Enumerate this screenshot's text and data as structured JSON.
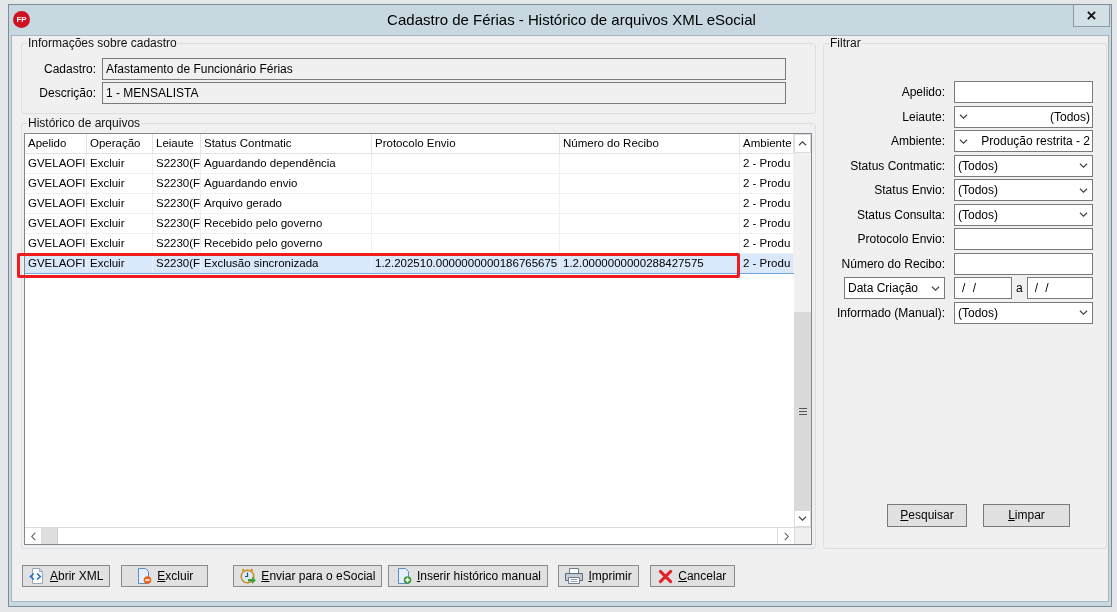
{
  "window": {
    "logo": "FP",
    "title": "Cadastro de Férias - Histórico de arquivos XML eSocial"
  },
  "info_group": {
    "legend": "Informações sobre cadastro",
    "fields": [
      {
        "label": "Cadastro:",
        "value": "Afastamento de Funcionário Férias"
      },
      {
        "label": "Descrição:",
        "value": "1 - MENSALISTA"
      }
    ]
  },
  "history_group": {
    "legend": "Histórico de arquivos",
    "table": {
      "columns": [
        "Apelido",
        "Operação",
        "Leiaute",
        "Status Contmatic",
        "Protocolo Envio",
        "Número do Recibo",
        "Ambiente"
      ],
      "rows": [
        {
          "apelido": "GVELAOFI",
          "operacao": "Excluir",
          "leiaute": "S2230(F",
          "status_contmatic": "Aguardando dependência",
          "ambiente": "2 - Produ",
          "selected": false,
          "highlighted": false
        },
        {
          "apelido": "GVELAOFI",
          "operacao": "Excluir",
          "leiaute": "S2230(F",
          "status_contmatic": "Aguardando envio",
          "ambiente": "2 - Produ",
          "selected": false,
          "highlighted": false
        },
        {
          "apelido": "GVELAOFI",
          "operacao": "Excluir",
          "leiaute": "S2230(F",
          "status_contmatic": "Arquivo gerado",
          "ambiente": "2 - Produ",
          "selected": false,
          "highlighted": false
        },
        {
          "apelido": "GVELAOFI",
          "operacao": "Excluir",
          "leiaute": "S2230(F",
          "status_contmatic": "Recebido pelo governo",
          "ambiente": "2 - Produ",
          "selected": false,
          "highlighted": false
        },
        {
          "apelido": "GVELAOFI",
          "operacao": "Excluir",
          "leiaute": "S2230(F",
          "status_contmatic": "Recebido pelo governo",
          "ambiente": "2 - Produ",
          "selected": false,
          "highlighted": false
        },
        {
          "apelido": "GVELAOFI",
          "operacao": "Excluir",
          "leiaute": "S2230(F",
          "status_contmatic": "Exclusão sincronizada",
          "protocolo_envio": "1.2.202510.0000000000186765675",
          "numero_do_recibo": "1.2.0000000000288427575",
          "ambiente": "2 - Produ",
          "selected": true,
          "highlighted": true
        }
      ]
    }
  },
  "filter_group": {
    "legend": "Filtrar",
    "fields": [
      {
        "kind": "input",
        "label": "Apelido:"
      },
      {
        "kind": "combo_reversed",
        "label": "Leiaute:",
        "value": "(Todos)"
      },
      {
        "kind": "combo_reversed",
        "label": "Ambiente:",
        "value": "Produção restrita - 2"
      },
      {
        "kind": "combo",
        "label": "Status Contmatic:",
        "value": "(Todos)"
      },
      {
        "kind": "combo",
        "label": "Status Envio:",
        "value": "(Todos)"
      },
      {
        "kind": "combo",
        "label": "Status Consulta:",
        "value": "(Todos)"
      },
      {
        "kind": "input",
        "label": "Protocolo Envio:"
      },
      {
        "kind": "input",
        "label": "Número do Recibo:"
      },
      {
        "kind": "date_range",
        "selector": "Data Criação",
        "from": "/ /",
        "separator": "a",
        "to": "/ /"
      },
      {
        "kind": "combo",
        "label": "Informado (Manual):",
        "value": "(Todos)"
      }
    ],
    "buttons": [
      {
        "label": "Pesquisar",
        "mnemonic": true
      },
      {
        "label": "Limpar",
        "mnemonic": true
      }
    ]
  },
  "buttons": [
    {
      "label": "Abrir XML",
      "mnemonic": true
    },
    {
      "label": "Excluir",
      "mnemonic": true
    },
    {
      "label": "Enviar para o eSocial",
      "mnemonic": true
    },
    {
      "label": "Inserir histórico manual",
      "mnemonic": true
    },
    {
      "label": "Imprimir",
      "mnemonic": true
    },
    {
      "label": "Cancelar",
      "mnemonic": true
    }
  ]
}
